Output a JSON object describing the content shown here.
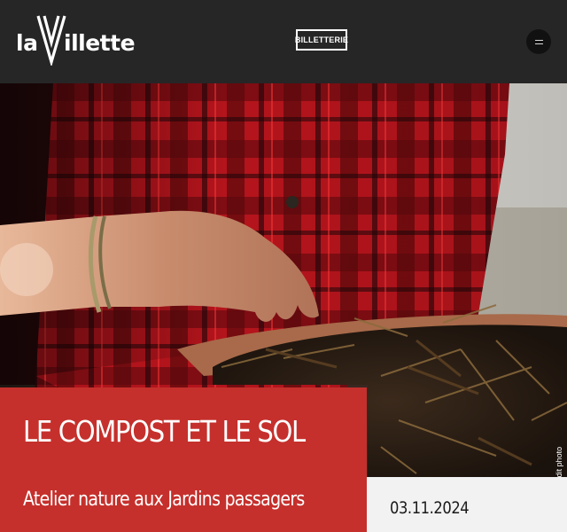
{
  "header": {
    "logo_text_la": "la",
    "logo_text_rest": "illette",
    "ticket_label": "BILLETTERIE",
    "menu_icon": "hamburger-menu-icon"
  },
  "hero": {
    "image_credit": "© Crédit photo"
  },
  "event": {
    "title": "LE COMPOST ET LE SOL",
    "subtitle": "Atelier nature aux Jardins passagers",
    "date": "03.11.2024"
  },
  "colors": {
    "header_bg": "#262626",
    "panel_red": "#c5302c",
    "date_bg": "#f2f2f2"
  }
}
